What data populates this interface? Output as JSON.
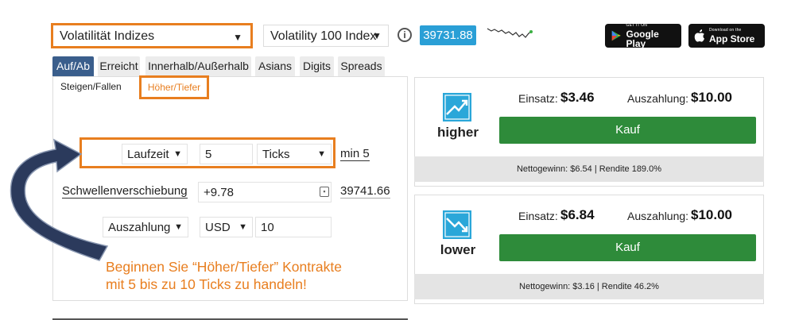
{
  "header": {
    "market_select": "Volatilität Indizes",
    "submarket_select": "Volatility 100 Index",
    "info_icon": "info-icon",
    "price": "39731.88",
    "google_play": {
      "small": "GET IT ON",
      "big": "Google Play"
    },
    "app_store": {
      "small": "Download on the",
      "big": "App Store"
    }
  },
  "tabs": [
    "Auf/Ab",
    "Erreicht",
    "Innerhalb/Außerhalb",
    "Asians",
    "Digits",
    "Spreads"
  ],
  "subtabs": [
    "Steigen/Fallen",
    "Höher/Tiefer"
  ],
  "form": {
    "duration_type": "Laufzeit",
    "duration_value": "5",
    "duration_unit": "Ticks",
    "duration_min": "min 5",
    "barrier_label": "Schwellenverschiebung",
    "barrier_value": "+9.78",
    "barrier_price": "39741.66",
    "payout_type": "Auszahlung",
    "currency": "USD",
    "amount": "10"
  },
  "contracts": [
    {
      "name": "higher",
      "stake_label": "Einsatz:",
      "stake": "$3.46",
      "payout_label": "Auszahlung:",
      "payout": "$10.00",
      "buy_label": "Kauf",
      "footer": "Nettogewinn: $6.54 | Rendite 189.0%"
    },
    {
      "name": "lower",
      "stake_label": "Einsatz:",
      "stake": "$6.84",
      "payout_label": "Auszahlung:",
      "payout": "$10.00",
      "buy_label": "Kauf",
      "footer": "Nettogewinn: $3.16 | Rendite 46.2%"
    }
  ],
  "annotation": {
    "line1": "Beginnen Sie “Höher/Tiefer” Kontrakte",
    "line2": "mit 5 bis zu 10 Ticks zu handeln!"
  },
  "colors": {
    "accent_orange": "#e87e1f",
    "tab_active": "#3a5e8c",
    "price_badge": "#2a9fd6",
    "buy_green": "#2e8b3a",
    "arrow_navy": "#2b3a5c"
  }
}
